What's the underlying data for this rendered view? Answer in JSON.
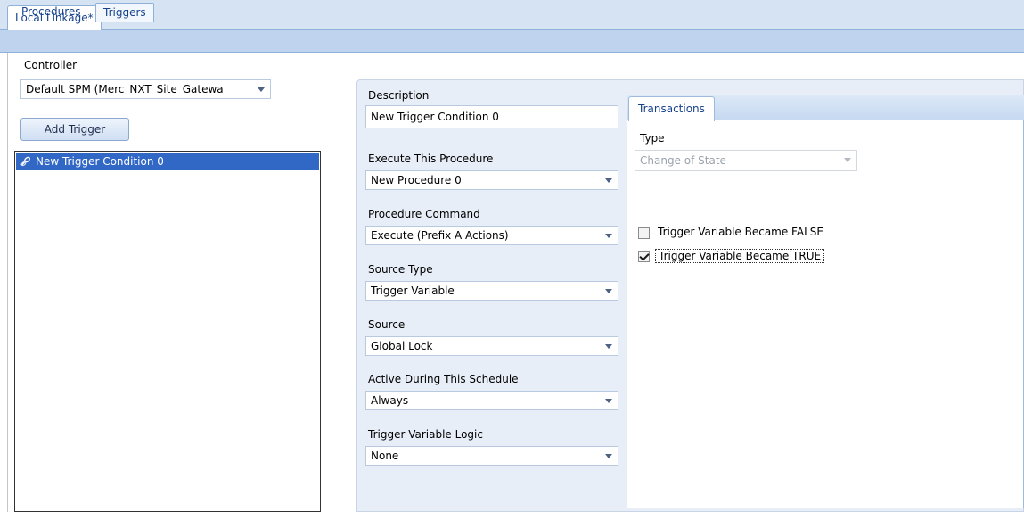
{
  "document_tab": {
    "label": "Local Linkage*"
  },
  "page_tabs": [
    {
      "label": "Procedures",
      "active": false
    },
    {
      "label": "Triggers",
      "active": true
    }
  ],
  "left": {
    "controller_label": "Controller",
    "controller_value": "Default SPM (Merc_NXT_Site_Gatewa",
    "add_trigger_label": "Add Trigger",
    "triggers": [
      {
        "label": "New Trigger Condition 0",
        "selected": true
      }
    ]
  },
  "form": {
    "description_label": "Description",
    "description_value": "New Trigger Condition 0",
    "execute_label": "Execute This Procedure",
    "execute_value": "New Procedure 0",
    "command_label": "Procedure Command",
    "command_value": "Execute (Prefix A Actions)",
    "source_type_label": "Source Type",
    "source_type_value": "Trigger Variable",
    "source_label": "Source",
    "source_value": "Global Lock",
    "schedule_label": "Active During This Schedule",
    "schedule_value": "Always",
    "logic_label": "Trigger Variable Logic",
    "logic_value": "None"
  },
  "transactions": {
    "tab_label": "Transactions",
    "type_label": "Type",
    "type_value": "Change of State",
    "false_label": "Trigger Variable Became FALSE",
    "false_checked": false,
    "true_label": "Trigger Variable Became TRUE",
    "true_checked": true
  },
  "colors": {
    "selection": "#3168c6",
    "tab_text": "#15428b",
    "panel_bg": "#e8eef7"
  }
}
